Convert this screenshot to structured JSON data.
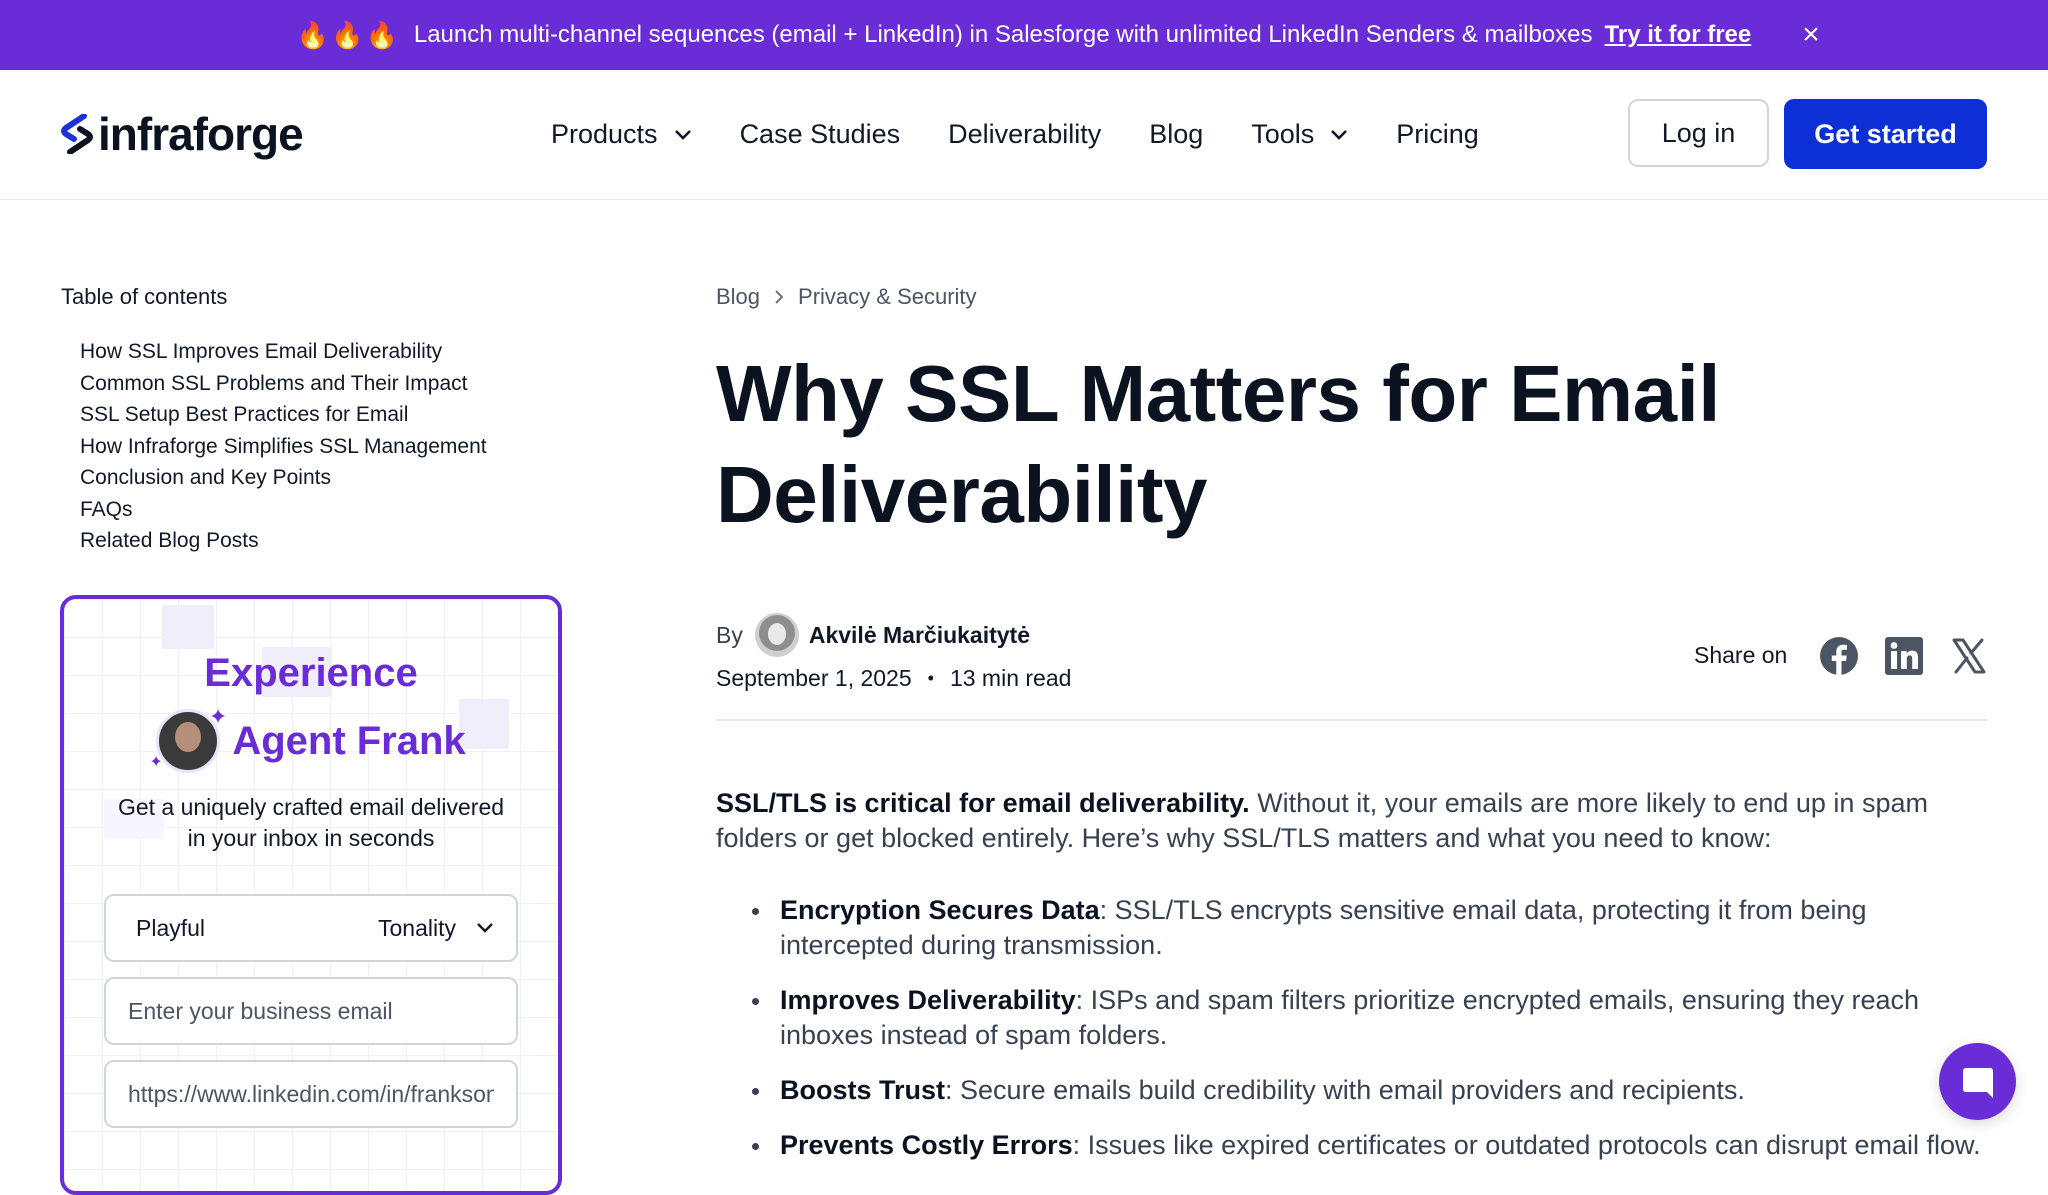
{
  "announcement": {
    "emoji": "🔥🔥🔥",
    "text": "Launch multi-channel sequences (email + LinkedIn) in Salesforge with unlimited LinkedIn Senders & mailboxes",
    "cta": "Try it for free",
    "close_icon": "close-icon",
    "close_glyph": "×"
  },
  "header": {
    "logo": "infraforge",
    "nav": [
      "Products",
      "Case Studies",
      "Deliverability",
      "Blog",
      "Tools",
      "Pricing"
    ],
    "login": "Log in",
    "get_started": "Get started"
  },
  "toc": {
    "title": "Table of contents",
    "items": [
      "How SSL Improves Email Deliverability",
      "Common SSL Problems and Their Impact",
      "SSL Setup Best Practices for Email",
      "How Infraforge Simplifies SSL Management",
      "Conclusion and Key Points",
      "FAQs",
      "Related Blog Posts"
    ]
  },
  "agent_card": {
    "title": "Experience",
    "name": "Agent Frank",
    "desc_line1": "Get a uniquely crafted email delivered",
    "desc_line2": "in your inbox in seconds",
    "tone_value": "Playful",
    "tone_label": "Tonality",
    "email_placeholder": "Enter your business email",
    "linkedin_placeholder": "https://www.linkedin.com/in/franksondors/"
  },
  "article": {
    "breadcrumb": [
      "Blog",
      "Privacy & Security"
    ],
    "title": "Why SSL Matters for Email Deliverability",
    "by": "By",
    "author": "Akvilė Marčiukaitytė",
    "date": "September 1, 2025",
    "dot": "•",
    "read_time": "13 min read",
    "share_label": "Share on",
    "lead_bold": "SSL/TLS is critical for email deliverability.",
    "lead_rest": " Without it, your emails are more likely to end up in spam folders or get blocked entirely. Here’s why SSL/TLS matters and what you need to know:",
    "bullets": [
      {
        "bold": "Encryption Secures Data",
        "text": ": SSL/TLS encrypts sensitive email data, protecting it from being intercepted during transmission."
      },
      {
        "bold": "Improves Deliverability",
        "text": ": ISPs and spam filters prioritize encrypted emails, ensuring they reach inboxes instead of spam folders."
      },
      {
        "bold": "Boosts Trust",
        "text": ": Secure emails build credibility with email providers and recipients."
      },
      {
        "bold": "Prevents Costly Errors",
        "text": ": Issues like expired certificates or outdated protocols can disrupt email flow."
      }
    ]
  },
  "icons": {
    "social": [
      "facebook-icon",
      "linkedin-icon",
      "x-icon"
    ],
    "chat": "chat-icon"
  },
  "colors": {
    "brand_purple": "#6a2cd6",
    "primary_blue": "#0c2fd6"
  }
}
